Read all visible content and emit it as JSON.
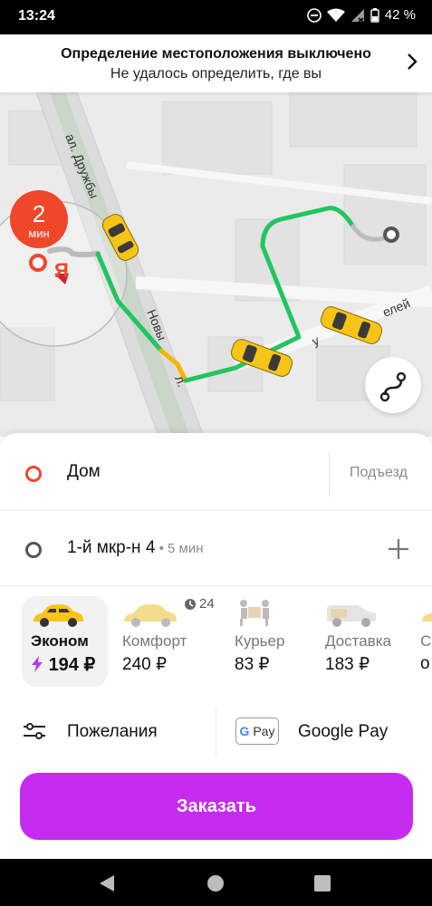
{
  "status_bar": {
    "time": "13:24",
    "battery": "42 %"
  },
  "location_banner": {
    "title": "Определение местоположения выключено",
    "subtitle": "Не удалось определить, где вы"
  },
  "map": {
    "street_1": "ал. Дружбы",
    "street_2": "Новы",
    "street_2_tail": "л.",
    "street_3": "у",
    "street_3_tail": "елей",
    "eta_value": "2",
    "eta_unit": "мин",
    "pin_label": "Я"
  },
  "route": {
    "from": "Дом",
    "entrance": "Подъезд",
    "to": "1-й мкр-н 4",
    "to_eta": " • 5 мин"
  },
  "tariffs": [
    {
      "name": "Эконом",
      "price": "194 ₽",
      "selected": true
    },
    {
      "name": "Комфорт",
      "price": "240 ₽",
      "badge": "24"
    },
    {
      "name": "Курьер",
      "price": "83 ₽"
    },
    {
      "name": "Доставка",
      "price": "183 ₽"
    },
    {
      "name": "С",
      "price": "о"
    }
  ],
  "options": {
    "wishes": "Пожелания",
    "gpay_badge": "Pay",
    "payment": "Google Pay"
  },
  "order_button": "Заказать",
  "colors": {
    "accent": "#c62bf0",
    "route_green": "#22c55e",
    "route_yellow": "#f5b400",
    "pin": "#f0472a"
  }
}
